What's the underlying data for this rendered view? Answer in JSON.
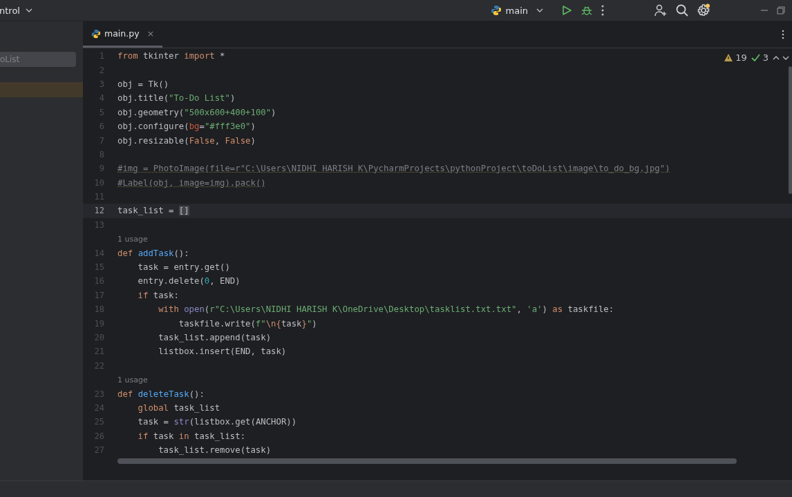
{
  "title_bar": {
    "project": "ntrol",
    "branch": "main"
  },
  "sidebar": {
    "search_value": "oList",
    "rows": [
      {
        "selected": true
      }
    ]
  },
  "tabs": [
    {
      "label": "main.py",
      "selected": true,
      "close": "×"
    }
  ],
  "inspections": {
    "warnings": "19",
    "checks": "3"
  },
  "code": [
    {
      "kind": "line",
      "number": "1",
      "current": false,
      "tokens": [
        {
          "keyword": "from"
        },
        {
          "plain": " tkinter "
        },
        {
          "keyword": "import"
        },
        {
          "plain": " *"
        }
      ]
    },
    {
      "kind": "line",
      "number": "2",
      "current": false
    },
    {
      "kind": "line",
      "number": "3",
      "current": false,
      "tokens": [
        {
          "plain": "obj = Tk()"
        }
      ]
    },
    {
      "kind": "line",
      "number": "4",
      "current": false,
      "tokens": [
        {
          "plain": "obj.title("
        },
        {
          "string": "\"To-Do List\""
        },
        {
          "plain": ")"
        }
      ]
    },
    {
      "kind": "line",
      "number": "5",
      "current": false,
      "tokens": [
        {
          "plain": "obj.geometry("
        },
        {
          "string": "\"500x600+400+100\""
        },
        {
          "plain": ")"
        }
      ]
    },
    {
      "kind": "line",
      "number": "6",
      "current": false,
      "tokens": [
        {
          "plain": "obj.configure("
        },
        {
          "param": "bg"
        },
        {
          "plain": "="
        },
        {
          "string": "\"#fff3e0\""
        },
        {
          "plain": ")"
        }
      ]
    },
    {
      "kind": "line",
      "number": "7",
      "current": false,
      "tokens": [
        {
          "plain": "obj.resizable("
        },
        {
          "keyword": "False"
        },
        {
          "plain": ", "
        },
        {
          "keyword": "False"
        },
        {
          "plain": ")"
        }
      ]
    },
    {
      "kind": "line",
      "number": "8",
      "current": false
    },
    {
      "kind": "line",
      "number": "9",
      "current": false,
      "tokens": [
        {
          "comment": "#img = PhotoImage(file=r\"C:\\Users\\NIDHI HARISH K\\PycharmProjects\\pythonProject\\toDoList\\image\\to_do_bg.jpg\")"
        }
      ]
    },
    {
      "kind": "line",
      "number": "10",
      "current": false,
      "tokens": [
        {
          "comment": "#Label(obj, image=img).pack()"
        }
      ]
    },
    {
      "kind": "line",
      "number": "11",
      "current": false
    },
    {
      "kind": "line",
      "number": "12",
      "current": true,
      "tokens": [
        {
          "plain": "task_list = "
        },
        {
          "bracket": "[]"
        }
      ]
    },
    {
      "kind": "line",
      "number": "13",
      "current": false
    },
    {
      "kind": "hint",
      "text": "1 usage"
    },
    {
      "kind": "line",
      "number": "14",
      "current": false,
      "tokens": [
        {
          "keyword": "def "
        },
        {
          "function": "addTask"
        },
        {
          "plain": "():"
        }
      ],
      "children": [
        {
          "kind": "line",
          "number": "15",
          "current": false,
          "tokens": [
            {
              "plain": "task = entry.get()"
            }
          ]
        },
        {
          "kind": "line",
          "number": "16",
          "current": false,
          "tokens": [
            {
              "plain": "entry.delete("
            },
            {
              "number": "0"
            },
            {
              "plain": ", END)"
            }
          ]
        },
        {
          "kind": "line",
          "number": "17",
          "current": false,
          "tokens": [
            {
              "keyword": "if"
            },
            {
              "plain": " task:"
            }
          ],
          "children": [
            {
              "kind": "line",
              "number": "18",
              "current": false,
              "tokens": [
                {
                  "keyword": "with "
                },
                {
                  "builtin": "open"
                },
                {
                  "plain": "("
                },
                {
                  "string": "r\"C:\\Users\\NIDHI HARISH K\\OneDrive\\Desktop\\tasklist.txt.txt\""
                },
                {
                  "plain": ", "
                },
                {
                  "string": "'a'"
                },
                {
                  "plain": ") "
                },
                {
                  "keyword": "as"
                },
                {
                  "plain": " taskfile:"
                }
              ],
              "children": [
                {
                  "kind": "line",
                  "number": "19",
                  "current": false,
                  "tokens": [
                    {
                      "plain": "taskfile.write("
                    },
                    {
                      "string": "f\""
                    },
                    {
                      "keyword": "\\n{"
                    },
                    {
                      "plain": "task"
                    },
                    {
                      "keyword": "}"
                    },
                    {
                      "string": "\""
                    },
                    {
                      "plain": ")"
                    }
                  ]
                }
              ]
            },
            {
              "kind": "line",
              "number": "20",
              "current": false,
              "tokens": [
                {
                  "plain": "task_list.append(task)"
                }
              ]
            },
            {
              "kind": "line",
              "number": "21",
              "current": false,
              "tokens": [
                {
                  "plain": "listbox.insert(END, task)"
                }
              ]
            }
          ]
        }
      ]
    },
    {
      "kind": "line",
      "number": "22",
      "current": false
    },
    {
      "kind": "hint",
      "text": "1 usage"
    },
    {
      "kind": "line",
      "number": "23",
      "current": false,
      "tokens": [
        {
          "keyword": "def "
        },
        {
          "function": "deleteTask"
        },
        {
          "plain": "():"
        }
      ],
      "children": [
        {
          "kind": "line",
          "number": "24",
          "current": false,
          "tokens": [
            {
              "keyword": "global"
            },
            {
              "plain": " task_list"
            }
          ]
        },
        {
          "kind": "line",
          "number": "25",
          "current": false,
          "tokens": [
            {
              "plain": "task = "
            },
            {
              "builtin": "str"
            },
            {
              "plain": "(listbox.get(ANCHOR))"
            }
          ]
        },
        {
          "kind": "line",
          "number": "26",
          "current": false,
          "tokens": [
            {
              "keyword": "if"
            },
            {
              "plain": " task "
            },
            {
              "keyword": "in"
            },
            {
              "plain": " task_list:"
            }
          ],
          "children": [
            {
              "kind": "line",
              "number": "27",
              "current": false,
              "tokens": [
                {
                  "plain": "task_list.remove(task)"
                }
              ]
            }
          ]
        }
      ]
    }
  ]
}
